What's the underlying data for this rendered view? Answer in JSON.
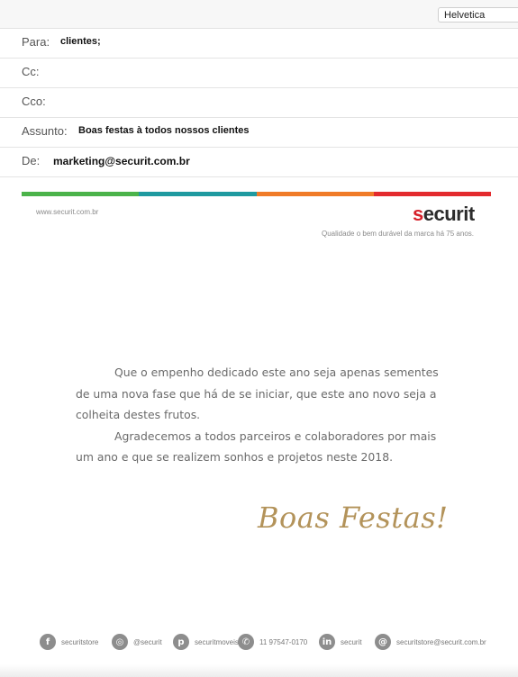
{
  "toolbar": {
    "font_value": "Helvetica"
  },
  "header": {
    "to": {
      "label": "Para:",
      "value": "clientes;"
    },
    "cc": {
      "label": "Cc:",
      "value": ""
    },
    "bcc": {
      "label": "Cco:",
      "value": ""
    },
    "subject": {
      "label": "Assunto:",
      "value": "Boas festas à todos nossos clientes"
    },
    "from": {
      "label": "De:",
      "value": "marketing@securit.com.br"
    }
  },
  "banner": {
    "stripe_colors": [
      "#4bb34a",
      "#1f9aa0",
      "#f07b28",
      "#e32b2e"
    ],
    "site_url": "www.securit.com.br",
    "logo_red": "s",
    "logo_rest": "ecurit",
    "tagline": "Qualidade o bem durável da marca há 75 anos."
  },
  "message": {
    "paragraph1": "Que o empenho dedicado este ano seja apenas sementes de uma nova fase que há de se iniciar, que este ano novo seja a colheita destes frutos.",
    "paragraph2": "Agradecemos a todos parceiros e colaboradores por mais um ano e que se realizem sonhos e projetos neste 2018.",
    "greeting": "Boas Festas!"
  },
  "footer": {
    "facebook": {
      "icon": "f",
      "text": "securitstore"
    },
    "instagram": {
      "icon": "◎",
      "text": "@securit"
    },
    "pinterest": {
      "icon": "p",
      "text": "securitmoveis"
    },
    "whatsapp": {
      "icon": "✆",
      "text": "11 97547-0170"
    },
    "linkedin": {
      "icon": "in",
      "text": "securit"
    },
    "email": {
      "icon": "@",
      "text": "securitstore@securit.com.br"
    }
  }
}
